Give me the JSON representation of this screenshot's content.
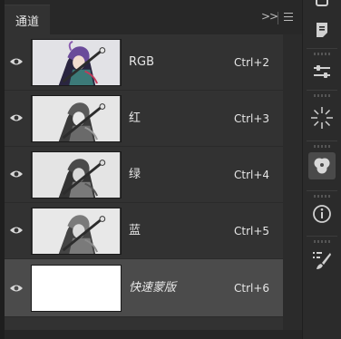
{
  "panel": {
    "tab_label": "通道",
    "tab_close": "×",
    "collapse_glyph": "»"
  },
  "channels": [
    {
      "name": "RGB",
      "shortcut": "Ctrl+2",
      "visible": true,
      "thumb": "color"
    },
    {
      "name": "红",
      "shortcut": "Ctrl+3",
      "visible": true,
      "thumb": "gray"
    },
    {
      "name": "绿",
      "shortcut": "Ctrl+4",
      "visible": true,
      "thumb": "gray"
    },
    {
      "name": "蓝",
      "shortcut": "Ctrl+5",
      "visible": true,
      "thumb": "gray"
    },
    {
      "name": "快速蒙版",
      "shortcut": "Ctrl+6",
      "visible": true,
      "thumb": "white",
      "selected": true
    }
  ],
  "toolbar": {
    "icons": [
      "cube-icon",
      "notes-icon",
      "adjustments-icon",
      "brightness-burst-icon",
      "channels-icon",
      "info-icon",
      "brush-settings-icon"
    ],
    "active": "channels-icon"
  },
  "colors": {
    "panel_bg": "#323232",
    "selected_row": "#4b4b4b",
    "text": "#e6e6e6"
  }
}
